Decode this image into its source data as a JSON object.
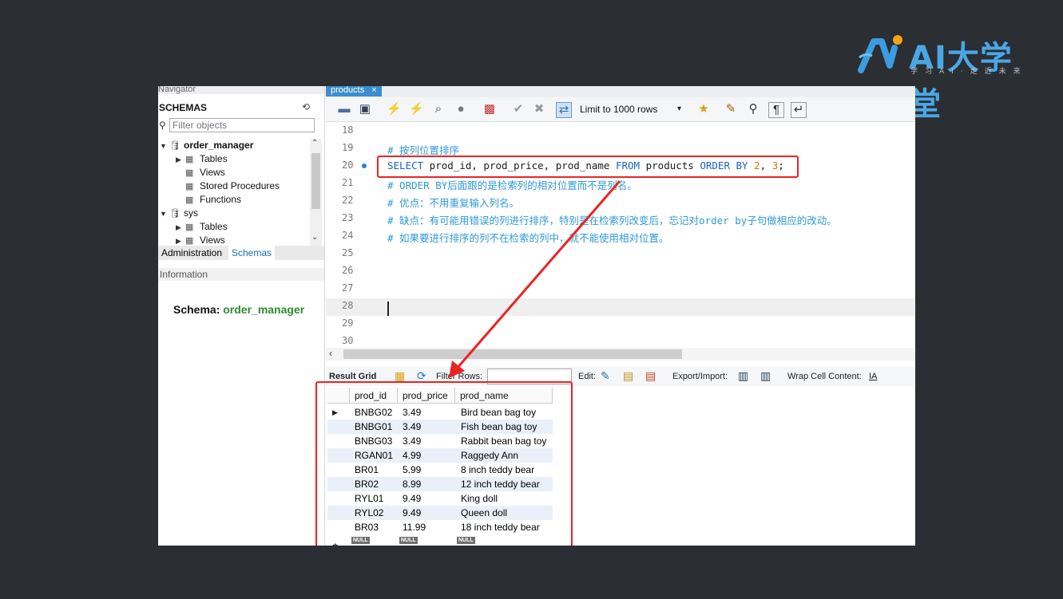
{
  "logo": {
    "brand": "AI大学堂",
    "tagline": "学习AI·走近未来"
  },
  "navigator": {
    "header": "Navigator",
    "schemas_title": "SCHEMAS",
    "filter_placeholder": "Filter objects",
    "tree": [
      {
        "label": "order_manager",
        "level": 0,
        "kind": "schema",
        "expanded": true
      },
      {
        "label": "Tables",
        "level": 1,
        "kind": "folder",
        "expanded": false
      },
      {
        "label": "Views",
        "level": 1,
        "kind": "folder"
      },
      {
        "label": "Stored Procedures",
        "level": 1,
        "kind": "folder"
      },
      {
        "label": "Functions",
        "level": 1,
        "kind": "folder"
      },
      {
        "label": "sys",
        "level": 0,
        "kind": "schema",
        "expanded": true
      },
      {
        "label": "Tables",
        "level": 1,
        "kind": "folder",
        "expanded": false
      },
      {
        "label": "Views",
        "level": 1,
        "kind": "folder",
        "expanded": false
      }
    ],
    "tabs": [
      "Administration",
      "Schemas"
    ],
    "active_tab": "Schemas",
    "info_header": "Information",
    "schema_label": "Schema:",
    "schema_value": "order_manager"
  },
  "editor": {
    "tab_name": "products",
    "tab_close": "×",
    "limit_label": "Limit to 1000 rows",
    "line_numbers": [
      "18",
      "19",
      "20",
      "21",
      "22",
      "23",
      "24",
      "25",
      "26",
      "27",
      "28",
      "29",
      "30"
    ],
    "lines": {
      "l19": "# 按列位置排序",
      "l20_select": "SELECT",
      "l20_cols": " prod_id, prod_price, prod_name ",
      "l20_from": "FROM",
      "l20_table": " products ",
      "l20_order": "ORDER BY",
      "l20_sp": " ",
      "l20_n1": "2",
      "l20_comma": ", ",
      "l20_n2": "3",
      "l20_end": ";",
      "l21": "# ORDER BY后面跟的是检索列的相对位置而不是列名。",
      "l22": "# 优点：不用重复输入列名。",
      "l23": "# 缺点：有可能用错误的列进行排序，特别是在检索列改变后，忘记对order by子句做相应的改动。",
      "l24": "# 如果要进行排序的列不在检索的列中，就不能使用相对位置。"
    }
  },
  "result_toolbar": {
    "result_grid": "Result Grid",
    "filter_rows": "Filter Rows:",
    "edit": "Edit:",
    "export_import": "Export/Import:",
    "wrap": "Wrap Cell Content:",
    "wrap_icon": "IA"
  },
  "grid": {
    "columns": [
      "prod_id",
      "prod_price",
      "prod_name"
    ],
    "rows": [
      [
        "BNBG02",
        "3.49",
        "Bird bean bag toy"
      ],
      [
        "BNBG01",
        "3.49",
        "Fish bean bag toy"
      ],
      [
        "BNBG03",
        "3.49",
        "Rabbit bean bag toy"
      ],
      [
        "RGAN01",
        "4.99",
        "Raggedy Ann"
      ],
      [
        "BR01",
        "5.99",
        "8 inch teddy bear"
      ],
      [
        "BR02",
        "8.99",
        "12 inch teddy bear"
      ],
      [
        "RYL01",
        "9.49",
        "King doll"
      ],
      [
        "RYL02",
        "9.49",
        "Queen doll"
      ],
      [
        "BR03",
        "11.99",
        "18 inch teddy bear"
      ]
    ],
    "null_label": "NULL"
  },
  "colors": {
    "highlight": "#ec2323",
    "comment": "#2f9ad7",
    "keyword": "#1a63c7",
    "number": "#e07000",
    "logo": "#4aa7e6"
  }
}
